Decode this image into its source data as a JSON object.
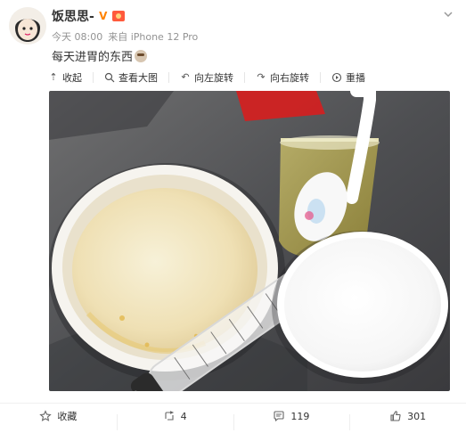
{
  "post": {
    "author": "饭思思-",
    "time": "今天 08:00",
    "source": "来自 iPhone 12 Pro",
    "text": "每天进胃的东西"
  },
  "toolbar": {
    "collapse": "收起",
    "view_large": "查看大图",
    "rotate_left": "向左旋转",
    "rotate_right": "向右旋转",
    "replay": "重播"
  },
  "actions": {
    "favorite": "收藏",
    "forward_count": "4",
    "comment_count": "119",
    "like_count": "301"
  },
  "icons": {
    "more": "chevron-down-icon",
    "verified": "v-badge-icon",
    "medal": "medal-icon",
    "emoji": "emoji-icon"
  },
  "colors": {
    "accent": "#ff8200",
    "muted": "#939393"
  }
}
